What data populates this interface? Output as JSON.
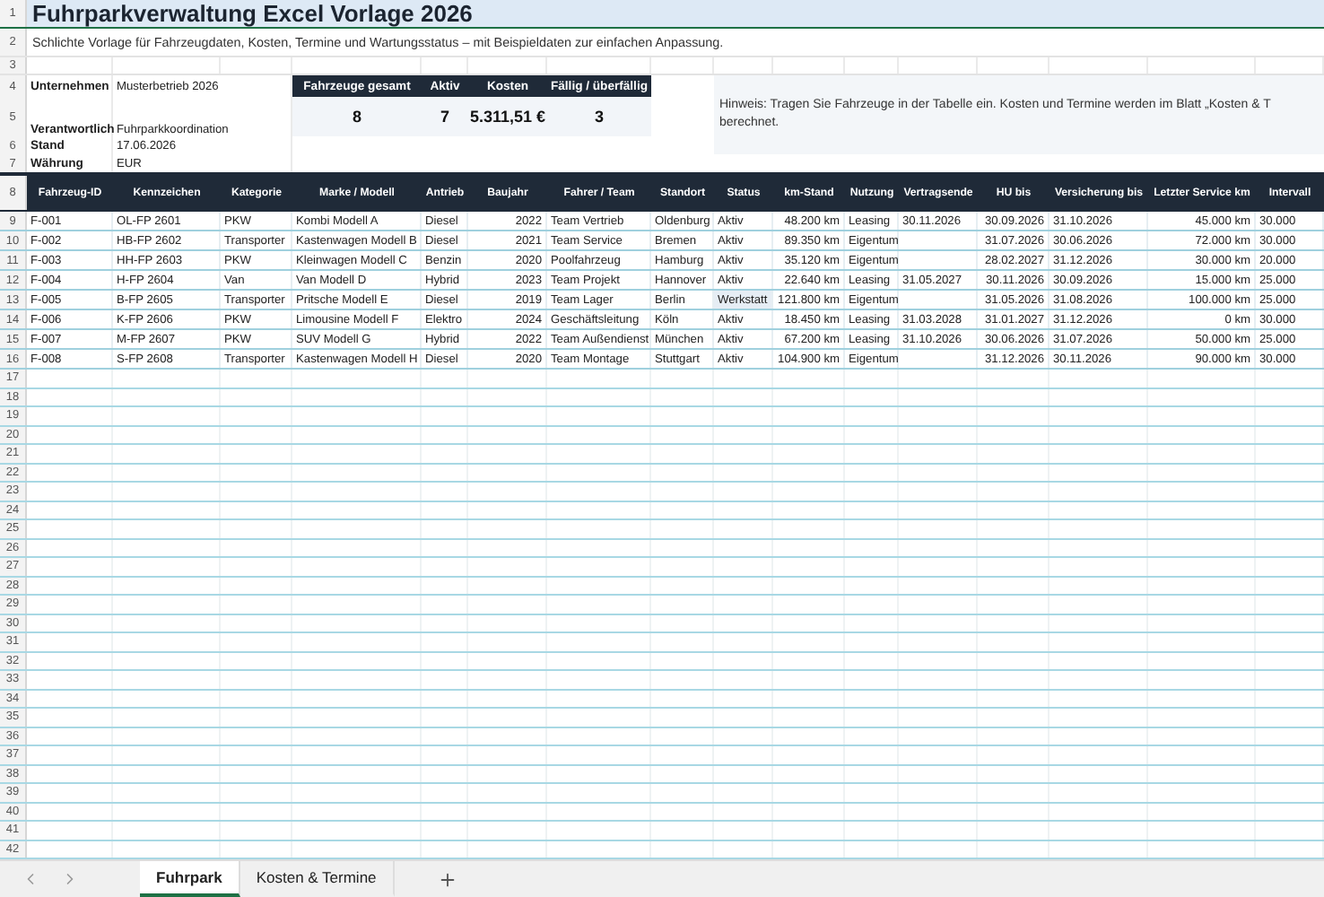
{
  "title_row": {
    "row_number": "1",
    "text": "Fuhrparkverwaltung Excel Vorlage 2026"
  },
  "subtitle_row": {
    "row_number": "2",
    "text": "Schlichte Vorlage für Fahrzeugdaten, Kosten, Termine und Wartungsstatus – mit Beispieldaten zur einfachen Anpassung."
  },
  "blank_row_number": "3",
  "info": [
    {
      "row_number": "4",
      "label": "Unternehmen",
      "value": "Musterbetrieb 2026"
    },
    {
      "row_number": "5",
      "label": "Verantwortlich",
      "value": "Fuhrparkkoordination"
    },
    {
      "row_number": "6",
      "label": "Stand",
      "value": "17.06.2026"
    },
    {
      "row_number": "7",
      "label": "Währung",
      "value": "EUR"
    }
  ],
  "kpis": [
    {
      "label": "Fahrzeuge gesamt",
      "value": "8"
    },
    {
      "label": "Aktiv",
      "value": "7"
    },
    {
      "label": "Kosten",
      "value": "5.311,51 €"
    },
    {
      "label": "Fällig / überfällig",
      "value": "3"
    }
  ],
  "hint": [
    "Hinweis: Tragen Sie Fahrzeuge in der Tabelle ein. Kosten und Termine werden im Blatt „Kosten & T",
    "berechnet."
  ],
  "table": {
    "row_number": "8",
    "columns": [
      {
        "label": "Fahrzeug-ID",
        "kind": "text"
      },
      {
        "label": "Kennzeichen",
        "kind": "text"
      },
      {
        "label": "Kategorie",
        "kind": "text"
      },
      {
        "label": "Marke / Modell",
        "kind": "text"
      },
      {
        "label": "Antrieb",
        "kind": "text"
      },
      {
        "label": "Baujahr",
        "kind": "number"
      },
      {
        "label": "Fahrer / Team",
        "kind": "text"
      },
      {
        "label": "Standort",
        "kind": "text"
      },
      {
        "label": "Status",
        "kind": "text"
      },
      {
        "label": "km-Stand",
        "kind": "number"
      },
      {
        "label": "Nutzung",
        "kind": "text"
      },
      {
        "label": "Vertragsende",
        "kind": "text"
      },
      {
        "label": "HU bis",
        "kind": "number"
      },
      {
        "label": "Versicherung bis",
        "kind": "text"
      },
      {
        "label": "Letzter Service km",
        "kind": "number"
      },
      {
        "label": "Intervall",
        "kind": "text"
      }
    ],
    "rows": [
      {
        "row_number": "9",
        "status_highlight": false,
        "cells": [
          "F-001",
          "OL-FP 2601",
          "PKW",
          "Kombi Modell A",
          "Diesel",
          "2022",
          "Team Vertrieb",
          "Oldenburg",
          "Aktiv",
          "48.200 km",
          "Leasing",
          "30.11.2026",
          "30.09.2026",
          "31.10.2026",
          "45.000 km",
          "30.000"
        ]
      },
      {
        "row_number": "10",
        "status_highlight": false,
        "cells": [
          "F-002",
          "HB-FP 2602",
          "Transporter",
          "Kastenwagen Modell B",
          "Diesel",
          "2021",
          "Team Service",
          "Bremen",
          "Aktiv",
          "89.350 km",
          "Eigentum",
          null,
          "31.07.2026",
          "30.06.2026",
          "72.000 km",
          "30.000"
        ]
      },
      {
        "row_number": "11",
        "status_highlight": false,
        "cells": [
          "F-003",
          "HH-FP 2603",
          "PKW",
          "Kleinwagen Modell C",
          "Benzin",
          "2020",
          "Poolfahrzeug",
          "Hamburg",
          "Aktiv",
          "35.120 km",
          "Eigentum",
          null,
          "28.02.2027",
          "31.12.2026",
          "30.000 km",
          "20.000"
        ]
      },
      {
        "row_number": "12",
        "status_highlight": false,
        "cells": [
          "F-004",
          "H-FP 2604",
          "Van",
          "Van Modell D",
          "Hybrid",
          "2023",
          "Team Projekt",
          "Hannover",
          "Aktiv",
          "22.640 km",
          "Leasing",
          "31.05.2027",
          "30.11.2026",
          "30.09.2026",
          "15.000 km",
          "25.000"
        ]
      },
      {
        "row_number": "13",
        "status_highlight": true,
        "cells": [
          "F-005",
          "B-FP 2605",
          "Transporter",
          "Pritsche Modell E",
          "Diesel",
          "2019",
          "Team Lager",
          "Berlin",
          "Werkstatt",
          "121.800 km",
          "Eigentum",
          null,
          "31.05.2026",
          "31.08.2026",
          "100.000 km",
          "25.000"
        ]
      },
      {
        "row_number": "14",
        "status_highlight": false,
        "cells": [
          "F-006",
          "K-FP 2606",
          "PKW",
          "Limousine Modell F",
          "Elektro",
          "2024",
          "Geschäftsleitung",
          "Köln",
          "Aktiv",
          "18.450 km",
          "Leasing",
          "31.03.2028",
          "31.01.2027",
          "31.12.2026",
          "0 km",
          "30.000"
        ]
      },
      {
        "row_number": "15",
        "status_highlight": false,
        "cells": [
          "F-007",
          "M-FP 2607",
          "PKW",
          "SUV Modell G",
          "Hybrid",
          "2022",
          "Team Außendienst",
          "München",
          "Aktiv",
          "67.200 km",
          "Leasing",
          "31.10.2026",
          "30.06.2026",
          "31.07.2026",
          "50.000 km",
          "25.000"
        ]
      },
      {
        "row_number": "16",
        "status_highlight": false,
        "cells": [
          "F-008",
          "S-FP 2608",
          "Transporter",
          "Kastenwagen Modell H",
          "Diesel",
          "2020",
          "Team Montage",
          "Stuttgart",
          "Aktiv",
          "104.900 km",
          "Eigentum",
          null,
          "31.12.2026",
          "30.11.2026",
          "90.000 km",
          "30.000"
        ]
      }
    ]
  },
  "empty_rows": [
    "17",
    "18",
    "19",
    "20",
    "21",
    "22",
    "23",
    "24",
    "25",
    "26",
    "27",
    "28",
    "29",
    "30",
    "31",
    "32",
    "33",
    "34",
    "35",
    "36",
    "37",
    "38",
    "39",
    "40",
    "41",
    "42"
  ],
  "sheet_tabs": [
    {
      "label": "Fuhrpark",
      "selected": true
    },
    {
      "label": "Kosten & Termine",
      "selected": false
    }
  ]
}
